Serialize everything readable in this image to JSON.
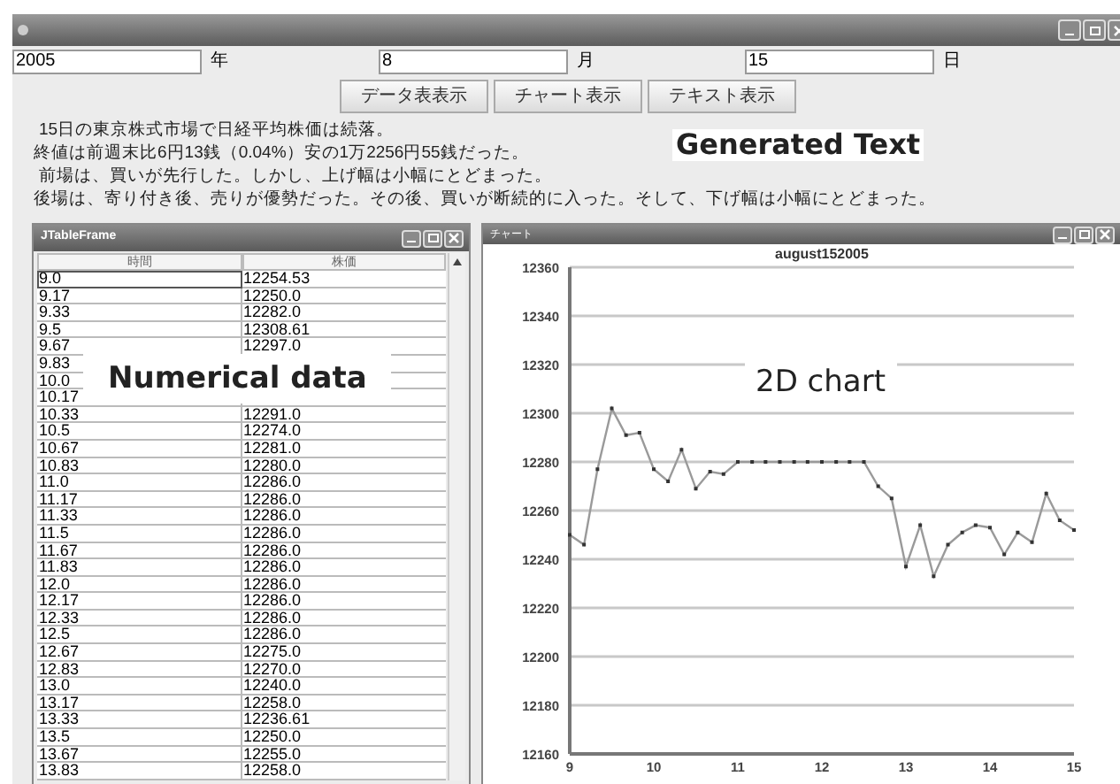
{
  "date_fields": [
    {
      "value": "2005",
      "unit": "年"
    },
    {
      "value": "8",
      "unit": "月"
    },
    {
      "value": "15",
      "unit": "日"
    }
  ],
  "buttons": [
    "データ表表示",
    "チャート表示",
    "テキスト表示"
  ],
  "text_panel": {
    "lines": [
      "15日の東京株式市場で日経平均株価は続落。",
      "終値は前週末比6円13銭（0.04%）安の1万2256円55銭だった。",
      "前場は、買いが先行した。しかし、上げ幅は小幅にとどまった。",
      "後場は、寄り付き後、売りが優勢だった。その後、買いが断続的に入った。そして、下げ幅は小幅にとどまった。"
    ],
    "annotation": "Generated Text"
  },
  "table_frame": {
    "title": "JTableFrame",
    "columns": [
      "時間",
      "株価"
    ],
    "annotation": "Numerical data",
    "rows": [
      {
        "time": "9.0",
        "price": "12254.53",
        "selected": true
      },
      {
        "time": "9.17",
        "price": "12250.0",
        "selected": false
      },
      {
        "time": "9.33",
        "price": "12282.0",
        "selected": false
      },
      {
        "time": "9.5",
        "price": "12308.61",
        "selected": false
      },
      {
        "time": "9.67",
        "price": "12297.0",
        "selected": false
      },
      {
        "time": "9.83",
        "selected": false
      },
      {
        "time": "10.0",
        "selected": false
      },
      {
        "time": "10.17",
        "selected": false
      },
      {
        "time": "10.33",
        "price": "12291.0",
        "selected": false
      },
      {
        "time": "10.5",
        "price": "12274.0",
        "selected": false
      },
      {
        "time": "10.67",
        "price": "12281.0",
        "selected": false
      },
      {
        "time": "10.83",
        "price": "12280.0",
        "selected": false
      },
      {
        "time": "11.0",
        "price": "12286.0",
        "selected": false
      },
      {
        "time": "11.17",
        "price": "12286.0",
        "selected": false
      },
      {
        "time": "11.33",
        "price": "12286.0",
        "selected": false
      },
      {
        "time": "11.5",
        "price": "12286.0",
        "selected": false
      },
      {
        "time": "11.67",
        "price": "12286.0",
        "selected": false
      },
      {
        "time": "11.83",
        "price": "12286.0",
        "selected": false
      },
      {
        "time": "12.0",
        "price": "12286.0",
        "selected": false
      },
      {
        "time": "12.17",
        "price": "12286.0",
        "selected": false
      },
      {
        "time": "12.33",
        "price": "12286.0",
        "selected": false
      },
      {
        "time": "12.5",
        "price": "12286.0",
        "selected": false
      },
      {
        "time": "12.67",
        "price": "12275.0",
        "selected": false
      },
      {
        "time": "12.83",
        "price": "12270.0",
        "selected": false
      },
      {
        "time": "13.0",
        "price": "12240.0",
        "selected": false
      },
      {
        "time": "13.17",
        "price": "12258.0",
        "selected": false
      },
      {
        "time": "13.33",
        "price": "12236.61",
        "selected": false
      },
      {
        "time": "13.5",
        "price": "12250.0",
        "selected": false
      },
      {
        "time": "13.67",
        "price": "12255.0",
        "selected": false
      },
      {
        "time": "13.83",
        "price": "12258.0",
        "selected": false
      }
    ]
  },
  "chart_frame": {
    "title": "チャート",
    "annotation": "2D chart",
    "chart_data": {
      "type": "line",
      "title": "august152005",
      "x": [
        9.0,
        9.17,
        9.33,
        9.5,
        9.67,
        9.83,
        10.0,
        10.17,
        10.33,
        10.5,
        10.67,
        10.83,
        11.0,
        11.17,
        11.33,
        11.5,
        11.67,
        11.83,
        12.0,
        12.17,
        12.33,
        12.5,
        12.67,
        12.83,
        13.0,
        13.17,
        13.33,
        13.5,
        13.67,
        13.83,
        14.0,
        14.17,
        14.33,
        14.5,
        14.67,
        14.83,
        15.0
      ],
      "grid": true,
      "series": [
        {
          "color": "#9a9a9a",
          "marker": true,
          "values": [
            12250,
            12246,
            12277,
            12302,
            12291,
            12292,
            12277,
            12272,
            12285,
            12269,
            12276,
            12275,
            12280,
            12280,
            12280,
            12280,
            12280,
            12280,
            12280,
            12280,
            12280,
            12280,
            12270,
            12265,
            12237,
            12254,
            12233,
            12246,
            12251,
            12254,
            12253,
            12242,
            12251,
            12247,
            12267,
            12256,
            12252
          ]
        }
      ],
      "xlim": [
        9,
        15
      ],
      "ylim": [
        12160,
        12360
      ],
      "xticks": [
        9,
        10,
        11,
        12,
        13,
        14,
        15
      ],
      "yticks": [
        12160,
        12180,
        12200,
        12220,
        12240,
        12260,
        12280,
        12300,
        12320,
        12340,
        12360
      ]
    }
  }
}
